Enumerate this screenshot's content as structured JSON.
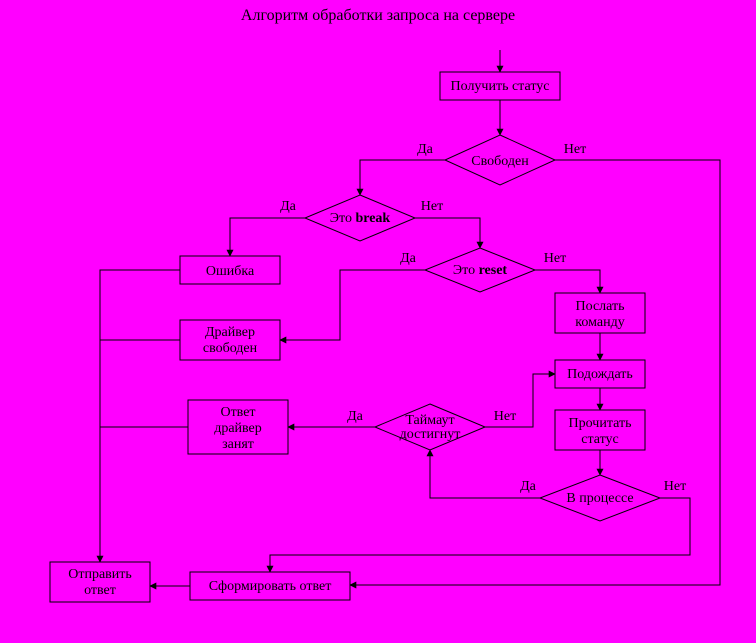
{
  "title": "Алгоритм обработки запроса на сервере",
  "labels": {
    "yes": "Да",
    "no": "Нет"
  },
  "nodes": {
    "get_status": "Получить статус",
    "free": "Свободен",
    "is_break_pre": "Это ",
    "is_break_word": "break",
    "is_reset_pre": "Это ",
    "is_reset_word": "reset",
    "error": "Ошибка",
    "driver_free_l1": "Драйвер",
    "driver_free_l2": "свободен",
    "send_l1": "Послать",
    "send_l2": "команду",
    "wait": "Подождать",
    "read_l1": "Прочитать",
    "read_l2": "статус",
    "in_progress": "В процессе",
    "timeout_l1": "Таймаут",
    "timeout_l2": "достигнут",
    "busy_l1": "Ответ",
    "busy_l2": "драйвер",
    "busy_l3": "занят",
    "form_answer": "Сформировать ответ",
    "send_ans_l1": "Отправить",
    "send_ans_l2": "ответ"
  }
}
